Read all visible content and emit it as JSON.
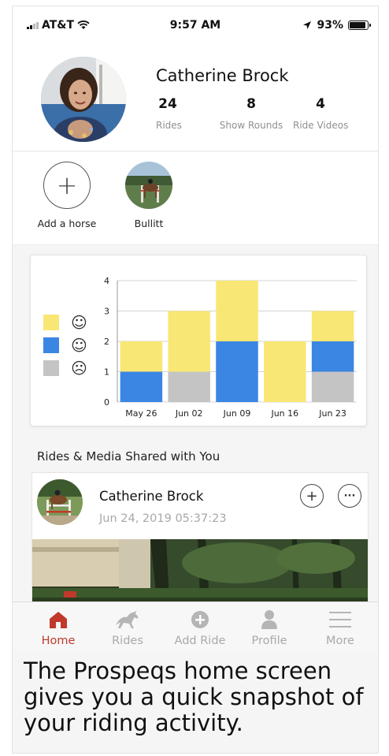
{
  "status_bar": {
    "carrier": "AT&T",
    "time": "9:57 AM",
    "battery": "93%",
    "battery_level": 0.93,
    "icons": [
      "signal-bars-icon",
      "wifi-icon",
      "location-arrow-icon",
      "battery-icon"
    ]
  },
  "profile": {
    "name": "Catherine Brock",
    "stats": [
      {
        "value": "24",
        "label": "Rides"
      },
      {
        "value": "8",
        "label": "Show Rounds"
      },
      {
        "value": "4",
        "label": "Ride Videos"
      }
    ]
  },
  "horses": {
    "add_label": "Add a horse",
    "add_symbol": "+",
    "items": [
      {
        "name": "Bullitt"
      }
    ]
  },
  "chart_data": {
    "type": "bar",
    "stacked": true,
    "categories": [
      "May 26",
      "Jun 02",
      "Jun 09",
      "Jun 16",
      "Jun 23"
    ],
    "series": [
      {
        "key": "sad",
        "color": "#c4c4c4",
        "values": [
          0,
          1,
          0,
          0,
          1
        ]
      },
      {
        "key": "neutral",
        "color": "#3b86e3",
        "values": [
          1,
          0,
          2,
          0,
          1
        ]
      },
      {
        "key": "happy",
        "color": "#f8e774",
        "values": [
          1,
          2,
          2,
          2,
          1
        ]
      }
    ],
    "ylim": [
      0,
      4
    ],
    "yticks": [
      "0",
      "1",
      "2",
      "3",
      "4"
    ],
    "grid": true,
    "legend_placement": "left",
    "legend": [
      {
        "color": "#f8e774",
        "icon": "smiley-happy-icon",
        "glyph": "☺"
      },
      {
        "color": "#3b86e3",
        "icon": "smiley-neutral-icon",
        "glyph": "☺"
      },
      {
        "color": "#c4c4c4",
        "icon": "smiley-sad-icon",
        "glyph": "☹"
      }
    ]
  },
  "section_title": "Rides & Media Shared with You",
  "ride": {
    "name": "Catherine Brock",
    "date": "Jun 24, 2019 05:37:23",
    "add_symbol": "+",
    "more_symbol": "···"
  },
  "tabs": [
    {
      "label": "Home",
      "icon": "home-icon",
      "active": true
    },
    {
      "label": "Rides",
      "icon": "horse-icon",
      "active": false
    },
    {
      "label": "Add Ride",
      "icon": "add-circle-icon",
      "active": false
    },
    {
      "label": "Profile",
      "icon": "person-icon",
      "active": false
    },
    {
      "label": "More",
      "icon": "menu-icon",
      "active": false
    }
  ],
  "colors": {
    "accent": "#c0392b",
    "yellow": "#f8e774",
    "blue": "#3b86e3",
    "gray": "#c4c4c4"
  },
  "caption": "The Prospeqs home screen gives you a quick snapshot of your riding activity."
}
